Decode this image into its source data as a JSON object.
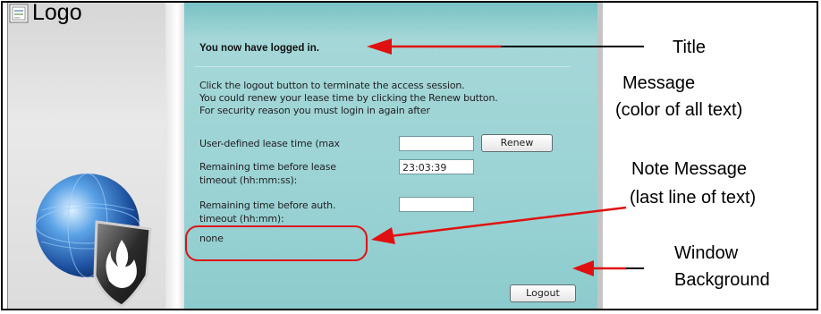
{
  "logo": {
    "label": "Logo",
    "icon": "image-placeholder-icon"
  },
  "window": {
    "title": "You now have logged in.",
    "message_lines": [
      "Click the logout button to terminate the access session.",
      "You could renew your lease time by clicking the Renew button.",
      "For security reason you must login in again after"
    ],
    "lease_label": "User-defined lease time (max",
    "lease_value": "",
    "renew_button": "Renew",
    "remaining_lease_label_1": "Remaining time before lease",
    "remaining_lease_label_2": "timeout (hh:mm:ss):",
    "remaining_lease_value": "23:03:39",
    "remaining_auth_label_1": "Remaining time before auth.",
    "remaining_auth_label_2": "timeout (hh:mm):",
    "remaining_auth_value": "",
    "note": "none",
    "logout_button": "Logout"
  },
  "annotations": {
    "title": "Title",
    "message_1": "Message",
    "message_2": "(color of all text)",
    "note_1": "Note Message",
    "note_2": "(last line of text)",
    "background_1": "Window",
    "background_2": "Background"
  },
  "colors": {
    "annotation_red": "#e01010",
    "window_teal": "#9bd3d5"
  }
}
